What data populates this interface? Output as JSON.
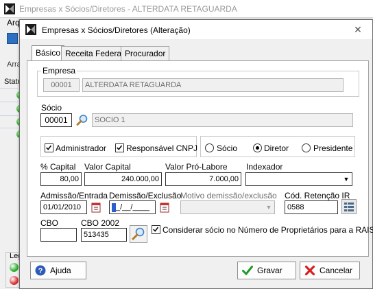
{
  "background_window": {
    "title": "Empresas x Sócios/Diretores - ALTERDATA RETAGUARDA",
    "menu_partial": "Arq",
    "tab_partial": "Arra",
    "status_partial": "Statu",
    "legend_partial": "Leg",
    "legend_colors": [
      "#2fae2f",
      "#d93030"
    ]
  },
  "dialog": {
    "title": "Empresas x Sócios/Diretores (Alteração)",
    "close_glyph": "✕",
    "tabs": [
      {
        "label": "Básico",
        "active": true
      },
      {
        "label": "Receita Federal",
        "active": false
      },
      {
        "label": "Procurador",
        "active": false
      }
    ],
    "empresa": {
      "group_label": "Empresa",
      "code": "00001",
      "name": "ALTERDATA RETAGUARDA"
    },
    "socio": {
      "label": "Sócio",
      "code": "00001",
      "name": "SOCIO 1"
    },
    "flags": {
      "administrador_label": "Administrador",
      "administrador_checked": true,
      "responsavel_label": "Responsável CNPJ",
      "responsavel_checked": true
    },
    "role": {
      "options": [
        "Sócio",
        "Diretor",
        "Presidente"
      ],
      "selected": "Diretor"
    },
    "values": {
      "capital_pct_label": "% Capital",
      "capital_pct": "80,00",
      "valor_capital_label": "Valor Capital",
      "valor_capital": "240.000,00",
      "pro_labore_label": "Valor Pró-Labore",
      "pro_labore": "7.000,00",
      "indexador_label": "Indexador",
      "indexador": ""
    },
    "dates": {
      "admissao_label": "Admissão/Entrada",
      "admissao": "01/01/2010",
      "demissao_label": "Demissão/Exclusão",
      "demissao_mask": "_/__/____",
      "motivo_label": "Motivo demissão/exclusão",
      "motivo": "",
      "retencao_label": "Cód. Retenção IR",
      "retencao": "0588"
    },
    "cbo": {
      "cbo_label": "CBO",
      "cbo": "",
      "cbo2002_label": "CBO 2002",
      "cbo2002": "513435",
      "rais_label": "Considerar sócio no Número de Proprietários para a RAIS",
      "rais_checked": true
    },
    "buttons": {
      "help": "Ajuda",
      "save": "Gravar",
      "cancel": "Cancelar"
    }
  }
}
